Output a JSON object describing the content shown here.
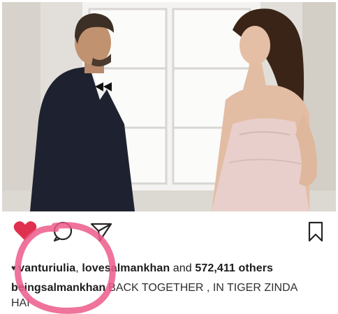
{
  "post": {
    "liked_by_user_1": "vanturiulia",
    "liked_by_separator": ", ",
    "liked_by_user_2": "lovesalmankhan",
    "and_text": " and ",
    "likes_count": "572,411 others",
    "caption_user": "beingsalmankhan",
    "caption_text": "BACK TOGETHER , IN TIGER ZINDA HAI"
  },
  "icons": {
    "like": "heart-icon",
    "comment": "comment-icon",
    "share": "send-icon",
    "save": "bookmark-icon"
  },
  "colors": {
    "like_heart": "#e0304f",
    "annotation_circle": "#ec5a8a",
    "icon_stroke": "#262626"
  }
}
